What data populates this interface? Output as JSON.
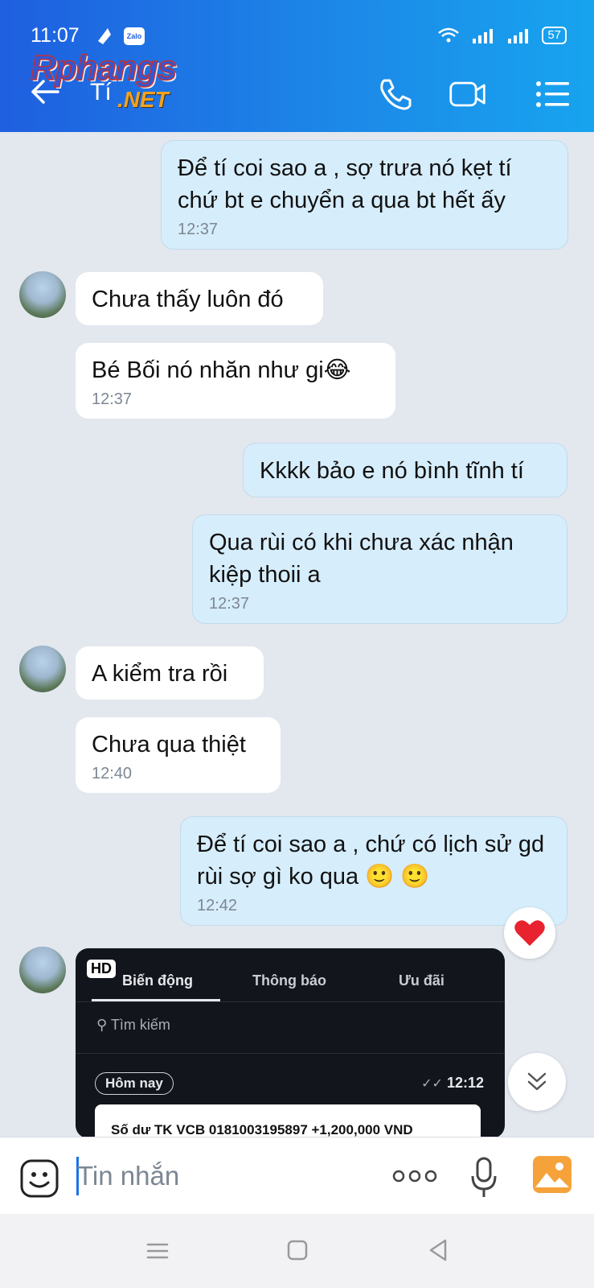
{
  "status": {
    "time": "11:07",
    "battery": "57",
    "zalo_badge": "Zalo"
  },
  "header": {
    "logo_line1": "Rphangs",
    "logo_line2": ".NET",
    "contact_name": "Tí"
  },
  "messages": [
    {
      "side": "sent",
      "text": "Để tí coi sao a , sợ trưa nó kẹt tí chứ bt e chuyển a qua bt hết ấy",
      "time": "12:37"
    },
    {
      "side": "recv",
      "text": "Chưa thấy luôn đó"
    },
    {
      "side": "recv",
      "text": "Bé Bối nó nhăn như gi😂",
      "time": "12:37"
    },
    {
      "side": "sent",
      "text": "Kkkk bảo e nó bình tĩnh tí"
    },
    {
      "side": "sent",
      "text": "Qua rùi có khi chưa xác nhận kiệp thoii a",
      "time": "12:37"
    },
    {
      "side": "recv",
      "text": "A kiểm tra rồi"
    },
    {
      "side": "recv",
      "text": "Chưa qua thiệt",
      "time": "12:40"
    },
    {
      "side": "sent",
      "text": "Để tí coi sao a , chứ có lịch sử gd rùi sợ gì ko qua 🙂 🙂",
      "time": "12:42"
    }
  ],
  "image_message": {
    "badge": "HD",
    "tabs": [
      "Biến động",
      "Thông báo",
      "Ưu đãi"
    ],
    "search": "Tìm kiếm",
    "day": "Hôm nay",
    "time": "12:12",
    "notification": "Số dư TK VCB 0181003195897 +1,200,000 VND"
  },
  "input": {
    "placeholder": "Tin nhắn"
  },
  "icons": {
    "back": "back-arrow-icon",
    "call": "phone-icon",
    "video": "video-icon",
    "menu": "list-menu-icon",
    "emoji": "emoji-icon",
    "more": "more-dots-icon",
    "mic": "microphone-icon",
    "gallery": "image-icon",
    "reaction": "heart-icon",
    "scroll": "double-chevron-down-icon"
  },
  "colors": {
    "header_start": "#1f5fe0",
    "header_end": "#17a4ef",
    "sent_bubble": "#d6edfb",
    "recv_bubble": "#ffffff",
    "background": "#e3e7ee"
  }
}
